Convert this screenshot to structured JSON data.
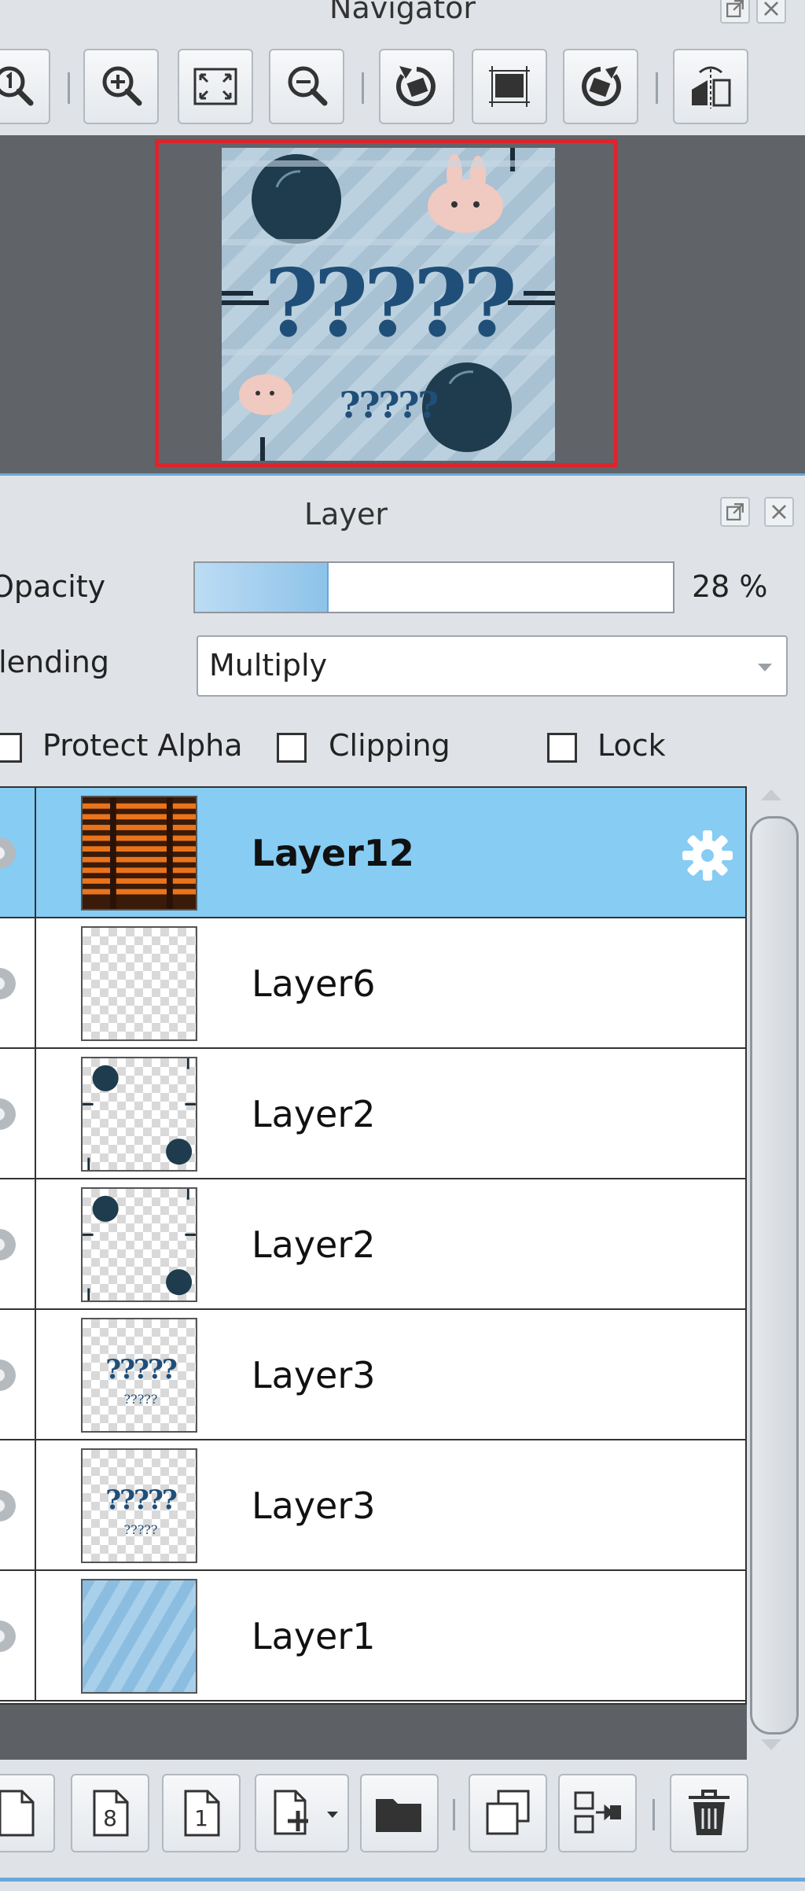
{
  "navigator": {
    "title": "Navigator",
    "toolbar": [
      {
        "icon": "zoom-actual-icon"
      },
      {
        "icon": "zoom-in-icon"
      },
      {
        "icon": "fit-to-window-icon"
      },
      {
        "icon": "zoom-out-icon"
      },
      {
        "icon": "rotate-left-icon"
      },
      {
        "icon": "reset-rotation-icon"
      },
      {
        "icon": "rotate-right-icon"
      },
      {
        "icon": "flip-horizontal-icon"
      }
    ],
    "preview": {
      "big_text": "?????",
      "small_text": "?????"
    },
    "frame_color": "#e0232a"
  },
  "layer_panel": {
    "title": "Layer",
    "opacity_label": "Opacity",
    "opacity_value": "28 %",
    "opacity_fraction": 0.28,
    "blending_label": "Blending",
    "blending_value": "Multiply",
    "protect_alpha_label": "Protect Alpha",
    "clipping_label": "Clipping",
    "lock_label": "Lock",
    "layers": [
      {
        "name": "Layer12",
        "selected": true,
        "thumb": "orange-blinds"
      },
      {
        "name": "Layer6",
        "selected": false,
        "thumb": "empty"
      },
      {
        "name": "Layer2",
        "selected": false,
        "thumb": "circles"
      },
      {
        "name": "Layer2",
        "selected": false,
        "thumb": "circles"
      },
      {
        "name": "Layer3",
        "selected": false,
        "thumb": "text"
      },
      {
        "name": "Layer3",
        "selected": false,
        "thumb": "text"
      },
      {
        "name": "Layer1",
        "selected": false,
        "thumb": "stripes"
      }
    ],
    "thumb_text": {
      "big": "?????",
      "small": "?????"
    },
    "bottom_toolbar": [
      {
        "icon": "new-layer-icon"
      },
      {
        "icon": "new-8bit-layer-icon",
        "text": "8"
      },
      {
        "icon": "new-1bit-layer-icon",
        "text": "1"
      },
      {
        "icon": "add-layer-dropdown-icon"
      },
      {
        "icon": "new-folder-icon"
      },
      {
        "icon": "duplicate-layer-icon"
      },
      {
        "icon": "merge-down-icon"
      },
      {
        "icon": "delete-layer-icon"
      }
    ]
  },
  "colors": {
    "selected_row": "#86ccf3",
    "accent_blue": "#6aa9da"
  }
}
